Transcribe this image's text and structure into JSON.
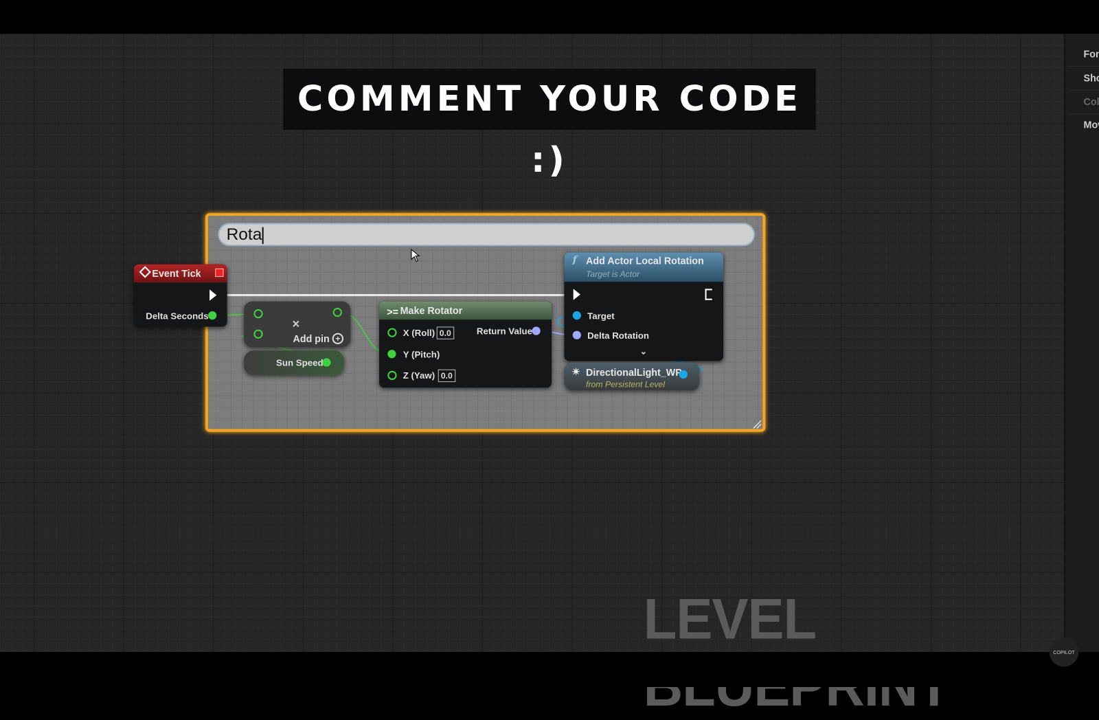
{
  "banner": {
    "text": "COMMENT YOUR CODE :)"
  },
  "details_panel": {
    "items": [
      {
        "label": "Fon",
        "dim": false
      },
      {
        "label": "Sho",
        "dim": false
      },
      {
        "label": "Colo",
        "dim": true
      },
      {
        "label": "Mov",
        "dim": false
      }
    ]
  },
  "comment_box": {
    "title_input_value": "Rota",
    "border_color": "#f2a425"
  },
  "nodes": {
    "event_tick": {
      "title": "Event Tick",
      "pin_delta_seconds": "Delta Seconds",
      "header_color": "#9b1c1c"
    },
    "multiply": {
      "operator": "×",
      "add_pin": "Add pin"
    },
    "sun_speed": {
      "label": "Sun Speed"
    },
    "make_rotator": {
      "title": "Make Rotator",
      "x_label": "X (Roll)",
      "x_value": "0.0",
      "y_label": "Y (Pitch)",
      "z_label": "Z (Yaw)",
      "z_value": "0.0",
      "return_value": "Return Value",
      "header_color": "#4f6e4f"
    },
    "add_actor_local_rotation": {
      "title": "Add Actor Local Rotation",
      "subtitle": "Target is Actor",
      "pin_target": "Target",
      "pin_delta_rotation": "Delta Rotation",
      "header_color": "#3f6f8f"
    },
    "directional_light": {
      "title": "DirectionalLight_WP",
      "subtitle": "from Persistent Level"
    }
  },
  "watermark": {
    "text": "LEVEL BLUEPRINT"
  },
  "copilot_badge": {
    "text": "COPILOT"
  },
  "pin_colors": {
    "exec": "#ffffff",
    "float": "#3fd13f",
    "rotator": "#a0a8ff",
    "object": "#1aa7e6"
  }
}
